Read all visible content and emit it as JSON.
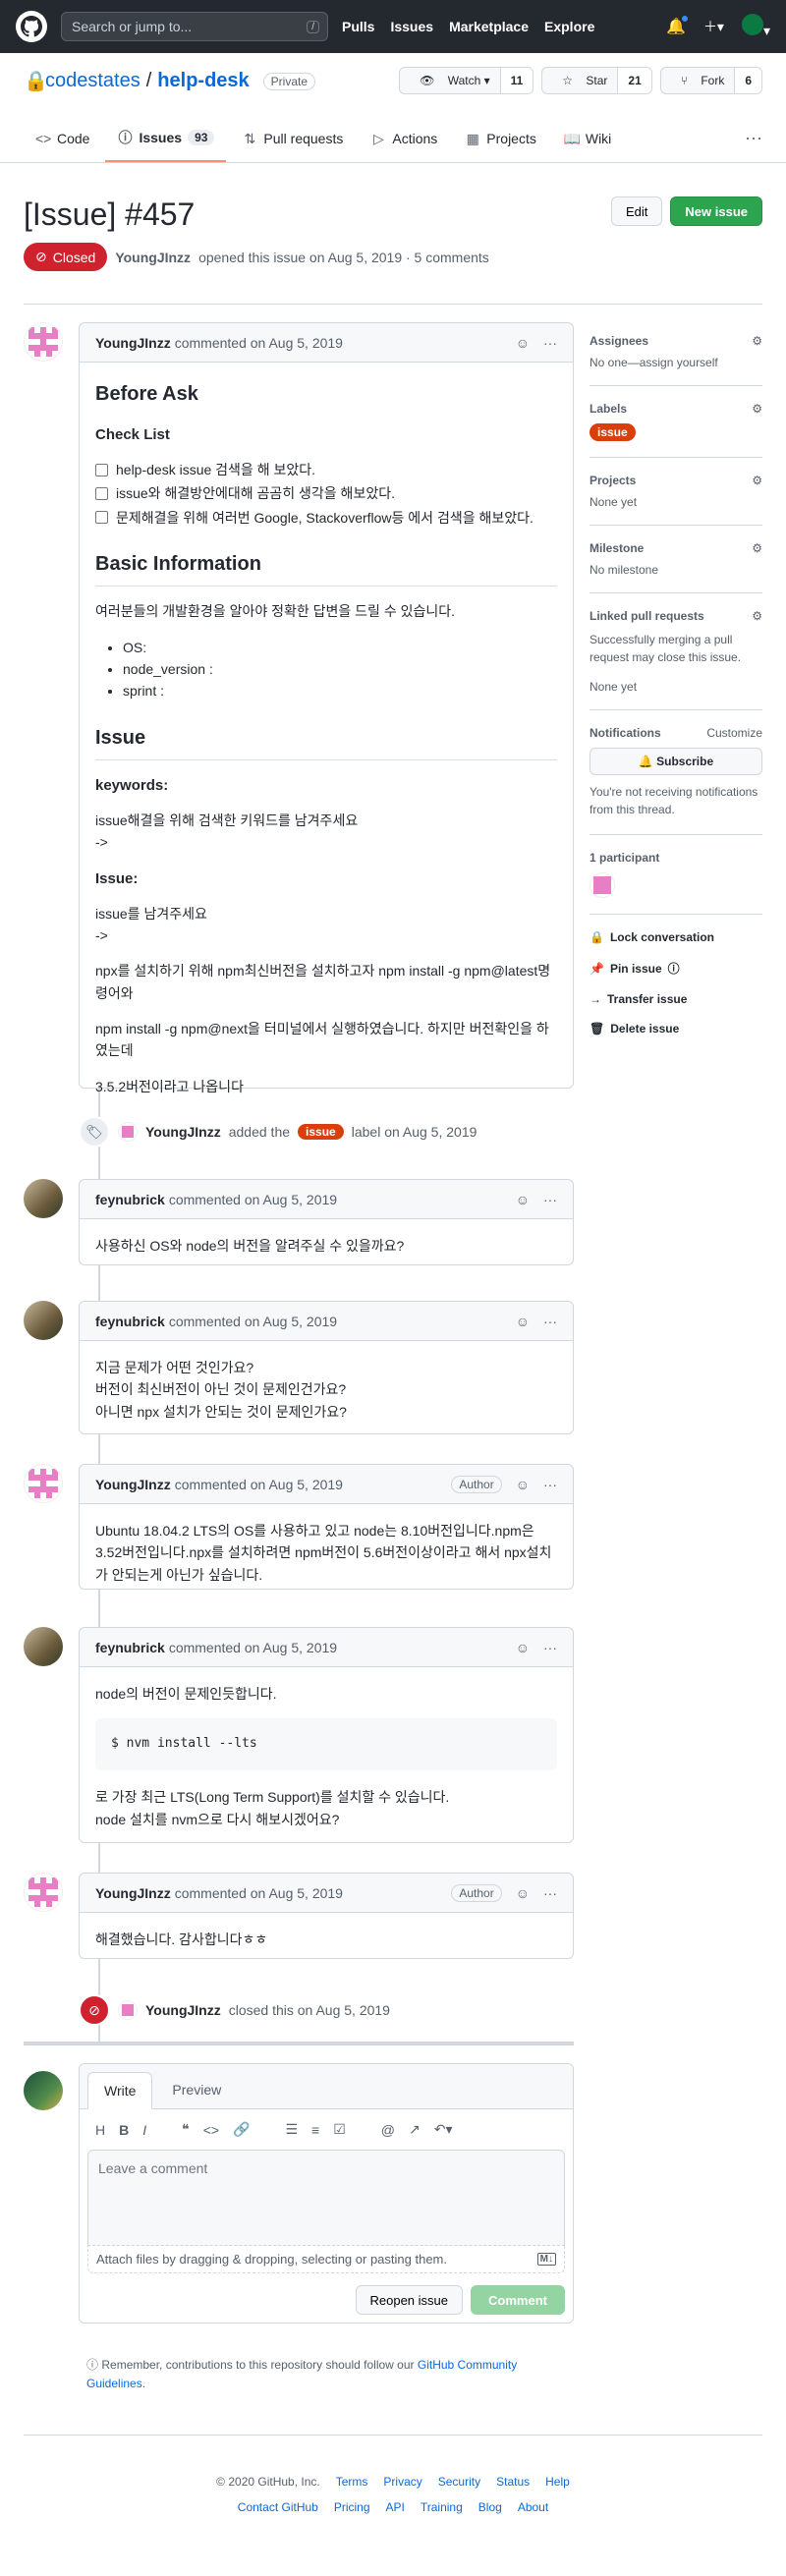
{
  "topbar": {
    "search_placeholder": "Search or jump to...",
    "slash_hint": "/",
    "nav": [
      "Pulls",
      "Issues",
      "Marketplace",
      "Explore"
    ]
  },
  "repo": {
    "owner": "codestates",
    "separator": "/",
    "name": "help-desk",
    "visibility": "Private",
    "watch_label": "Watch",
    "watch_count": "11",
    "star_label": "Star",
    "star_count": "21",
    "fork_label": "Fork",
    "fork_count": "6"
  },
  "tabs": [
    {
      "label": "Code"
    },
    {
      "label": "Issues",
      "count": "93"
    },
    {
      "label": "Pull requests"
    },
    {
      "label": "Actions"
    },
    {
      "label": "Projects"
    },
    {
      "label": "Wiki"
    }
  ],
  "issue": {
    "title": "[Issue] #457",
    "edit_label": "Edit",
    "new_issue_label": "New issue",
    "state": "Closed",
    "author": "YoungJInzz",
    "meta_text": "opened this issue on Aug 5, 2019 · 5 comments"
  },
  "comments": [
    {
      "author": "YoungJInzz",
      "when": "commented on Aug 5, 2019",
      "h_before": "Before Ask",
      "h_checklist": "Check List",
      "tasks": [
        "help-desk issue 검색을 해 보았다.",
        "issue와 해결방안에대해 곰곰히 생각을 해보았다.",
        "문제해결을 위해 여러번 Google, Stackoverflow등 에서 검색을 해보았다."
      ],
      "h_basic": "Basic Information",
      "basic_desc": "여러분들의 개발환경을 알아야 정확한 답변을 드릴 수 있습니다.",
      "basic_list": [
        "OS:",
        "node_version :",
        "sprint :"
      ],
      "h_issue": "Issue",
      "keywords_label": "keywords:",
      "keywords_text1": "issue해결을 위해 검색한 키워드를 남겨주세요",
      "keywords_text2": "->",
      "issue_label": "Issue:",
      "issue_text1": "issue를 남겨주세요",
      "issue_text2": "->",
      "p1": "npx를 설치하기 위해 npm최신버전을 설치하고자 npm install -g npm@latest명령어와",
      "p2": "npm install -g npm@next을 터미널에서 실행하였습니다. 하지만 버전확인을 하였는데",
      "p3": "3.5.2버전이라고 나옵니다"
    },
    {
      "author": "feynubrick",
      "when": "commented on Aug 5, 2019",
      "text": "사용하신 OS와 node의 버전을 알려주실 수 있을까요?"
    },
    {
      "author": "feynubrick",
      "when": "commented on Aug 5, 2019",
      "line1": "지금 문제가 어떤 것인가요?",
      "line2": "버전이 최신버전이 아닌 것이 문제인건가요?",
      "line3": "아니면 npx 설치가 안되는 것이 문제인가요?"
    },
    {
      "author": "YoungJInzz",
      "when": "commented on Aug 5, 2019",
      "badge": "Author",
      "text": "Ubuntu 18.04.2 LTS의 OS를 사용하고 있고 node는 8.10버전입니다.npm은 3.52버전입니다.npx를 설치하려면 npm버전이 5.6버전이상이라고 해서 npx설치가 안되는게 아닌가 싶습니다."
    },
    {
      "author": "feynubrick",
      "when": "commented on Aug 5, 2019",
      "text1": "node의 버전이 문제인듯합니다.",
      "code": "$ nvm install --lts",
      "line2": "로 가장 최근 LTS(Long Term Support)를 설치할 수 있습니다.",
      "line3": "node 설치를 nvm으로 다시 해보시겠어요?"
    },
    {
      "author": "YoungJInzz",
      "when": "commented on Aug 5, 2019",
      "badge": "Author",
      "text": "해결했습니다. 감사합니다ㅎㅎ"
    }
  ],
  "events": {
    "label_author": "YoungJInzz",
    "label_pre": "added the",
    "label_name": "issue",
    "label_post": "label on Aug 5, 2019",
    "closed_author": "YoungJInzz",
    "closed_text": "closed this on Aug 5, 2019"
  },
  "sidebar": {
    "assignees_title": "Assignees",
    "assignees_value": "No one—assign yourself",
    "labels_title": "Labels",
    "label_value": "issue",
    "projects_title": "Projects",
    "projects_value": "None yet",
    "milestone_title": "Milestone",
    "milestone_value": "No milestone",
    "linked_title": "Linked pull requests",
    "linked_desc": "Successfully merging a pull request may close this issue.",
    "linked_value": "None yet",
    "notifications_title": "Notifications",
    "customize": "Customize",
    "subscribe": "Subscribe",
    "notif_desc": "You're not receiving notifications from this thread.",
    "participants_title": "1 participant",
    "lock": "Lock conversation",
    "pin": "Pin issue",
    "transfer": "Transfer issue",
    "delete": "Delete issue"
  },
  "composer": {
    "tab_write": "Write",
    "tab_preview": "Preview",
    "placeholder": "Leave a comment",
    "attach": "Attach files by dragging & dropping, selecting or pasting them.",
    "reopen": "Reopen issue",
    "comment": "Comment"
  },
  "remember": {
    "text": "Remember, contributions to this repository should follow our",
    "link": "GitHub Community Guidelines",
    "end": "."
  },
  "footer": {
    "copyright": "© 2020 GitHub, Inc.",
    "row1": [
      "Terms",
      "Privacy",
      "Security",
      "Status",
      "Help"
    ],
    "row2": [
      "Contact GitHub",
      "Pricing",
      "API",
      "Training",
      "Blog",
      "About"
    ]
  }
}
